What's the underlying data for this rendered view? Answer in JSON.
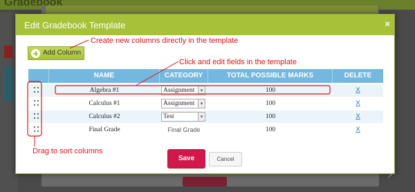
{
  "background": {
    "title": "Gradebook"
  },
  "modal": {
    "title": "Edit Gradebook Template",
    "close_icon": "×",
    "add_column_label": "Add Column",
    "columns": [
      "NAME",
      "CATEGORY",
      "TOTAL POSSIBLE MARKS",
      "DELETE"
    ],
    "rows": [
      {
        "name": "Algebra #1",
        "category": "Assignment",
        "category_editable": true,
        "marks": "100",
        "delete": "X"
      },
      {
        "name": "Calculus #1",
        "category": "Assignment",
        "category_editable": true,
        "marks": "100",
        "delete": "X"
      },
      {
        "name": "Calculus #2",
        "category": "Test",
        "category_editable": true,
        "marks": "100",
        "delete": "X"
      },
      {
        "name": "Final Grade",
        "category": "Final Grade",
        "category_editable": false,
        "marks": "100",
        "delete": "X"
      }
    ],
    "save_label": "Save",
    "cancel_label": "Cancel"
  },
  "annotations": {
    "create_columns": "Create new columns directly in the template",
    "edit_fields": "Click and edit fields in the template",
    "drag_sort": "Drag to sort columns"
  },
  "colors": {
    "header_green": "#a7c239",
    "table_header_blue": "#74b8df",
    "save_red": "#d2174a",
    "annotation_red": "#e01010"
  },
  "icons": {
    "add": "plus-circle-icon",
    "drag": "drag-handle-icon",
    "close": "close-icon",
    "dropdown": "chevron-down-icon"
  }
}
